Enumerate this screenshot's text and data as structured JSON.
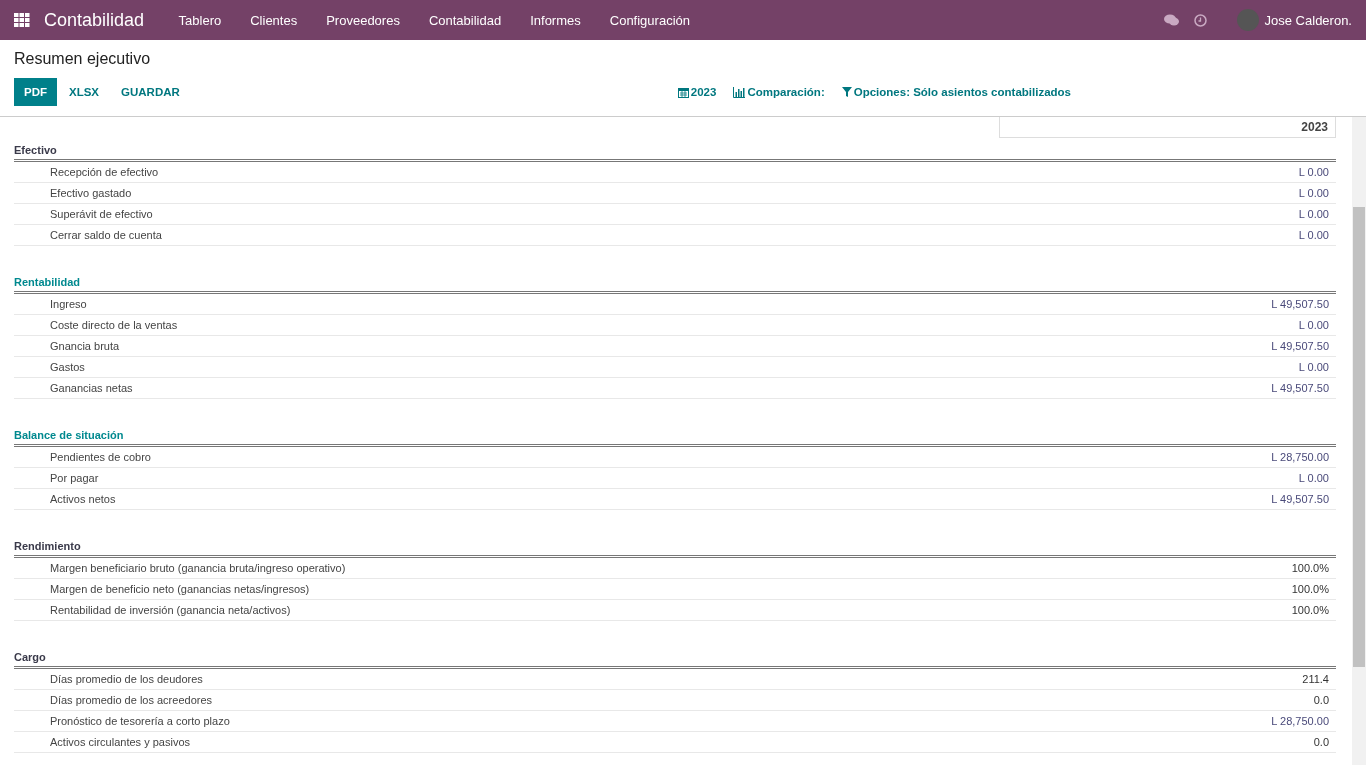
{
  "navbar": {
    "app_title": "Contabilidad",
    "menu": [
      "Tablero",
      "Clientes",
      "Proveedores",
      "Contabilidad",
      "Informes",
      "Configuración"
    ],
    "user": "Jose Calderon."
  },
  "page_title": "Resumen ejecutivo",
  "buttons": [
    {
      "label": "PDF",
      "primary": true
    },
    {
      "label": "XLSX",
      "primary": false
    },
    {
      "label": "GUARDAR",
      "primary": false
    }
  ],
  "filters": [
    {
      "kind": "date",
      "label": "2023"
    },
    {
      "kind": "comparison",
      "label": "Comparación:"
    },
    {
      "kind": "options",
      "label": "Opciones: Sólo asientos contabilizados"
    }
  ],
  "table": {
    "column": "2023",
    "sections": [
      {
        "title": "Efectivo",
        "linked": false,
        "rows": [
          {
            "label": "Recepción de efectivo",
            "value": "L 0.00",
            "linked": true
          },
          {
            "label": "Efectivo gastado",
            "value": "L 0.00",
            "linked": true
          },
          {
            "label": "Superávit de efectivo",
            "value": "L 0.00",
            "linked": true
          },
          {
            "label": "Cerrar saldo de cuenta",
            "value": "L 0.00",
            "linked": true
          }
        ]
      },
      {
        "title": "Rentabilidad",
        "linked": true,
        "rows": [
          {
            "label": "Ingreso",
            "value": "L 49,507.50",
            "linked": true
          },
          {
            "label": "Coste directo de la ventas",
            "value": "L 0.00",
            "linked": true
          },
          {
            "label": "Gnancia bruta",
            "value": "L 49,507.50",
            "linked": true
          },
          {
            "label": "Gastos",
            "value": "L 0.00",
            "linked": true
          },
          {
            "label": "Ganancias netas",
            "value": "L 49,507.50",
            "linked": true
          }
        ]
      },
      {
        "title": "Balance de situación",
        "linked": true,
        "rows": [
          {
            "label": "Pendientes de cobro",
            "value": "L 28,750.00",
            "linked": true
          },
          {
            "label": "Por pagar",
            "value": "L 0.00",
            "linked": true
          },
          {
            "label": "Activos netos",
            "value": "L 49,507.50",
            "linked": true
          }
        ]
      },
      {
        "title": "Rendimiento",
        "linked": false,
        "rows": [
          {
            "label": "Margen beneficiario bruto (ganancia bruta/ingreso operativo)",
            "value": "100.0%",
            "linked": false
          },
          {
            "label": "Margen de beneficio neto (ganancias netas/ingresos)",
            "value": "100.0%",
            "linked": false
          },
          {
            "label": "Rentabilidad de inversión (ganancia neta/activos)",
            "value": "100.0%",
            "linked": false
          }
        ]
      },
      {
        "title": "Cargo",
        "linked": false,
        "rows": [
          {
            "label": "Días promedio de los deudores",
            "value": "211.4",
            "linked": false
          },
          {
            "label": "Días promedio de los acreedores",
            "value": "0.0",
            "linked": false
          },
          {
            "label": "Pronóstico de tesorería a corto plazo",
            "value": "L 28,750.00",
            "linked": true
          },
          {
            "label": "Activos circulantes y pasivos",
            "value": "0.0",
            "linked": false
          }
        ]
      }
    ]
  }
}
